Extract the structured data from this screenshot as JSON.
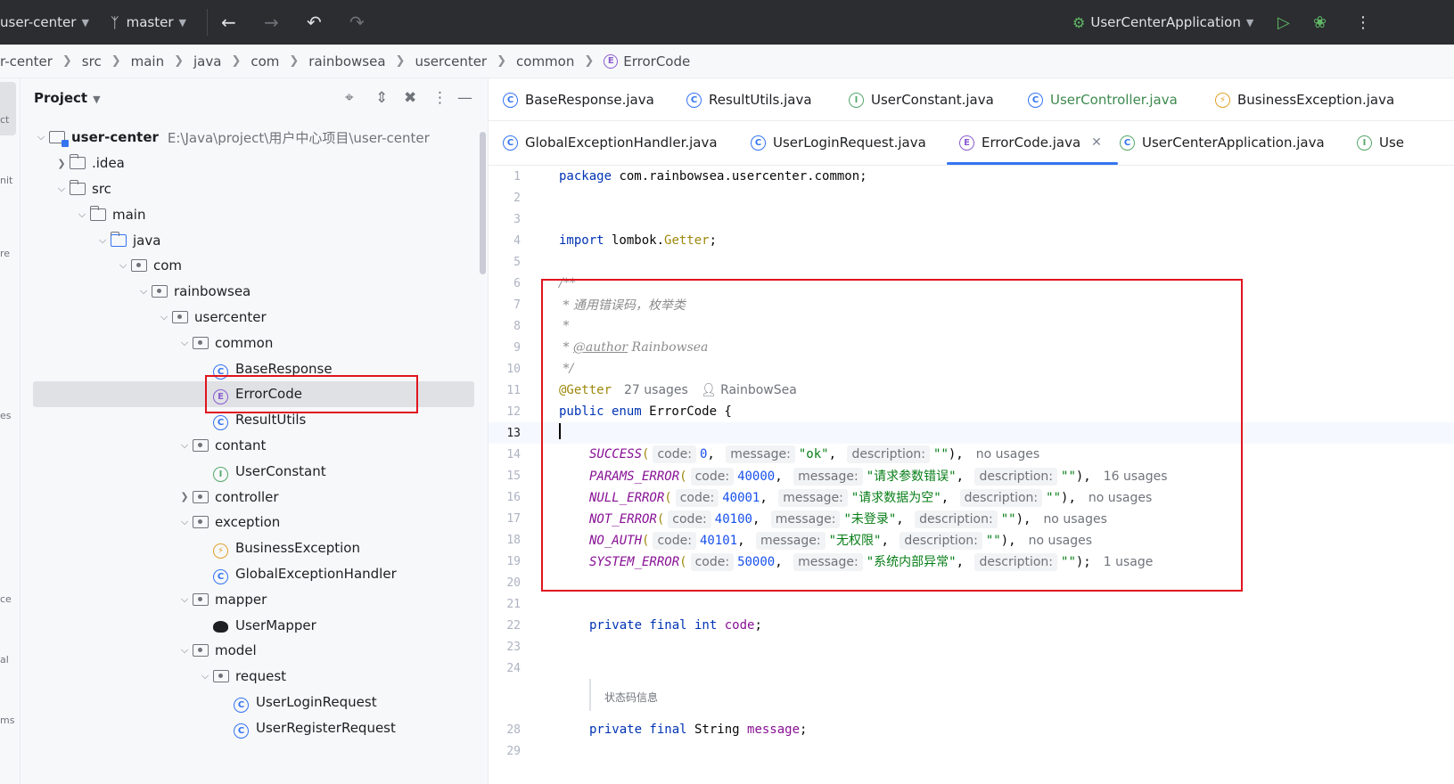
{
  "toolbar": {
    "project_name": "user-center",
    "branch": "master",
    "run_config": "UserCenterApplication"
  },
  "breadcrumb": [
    "r-center",
    "src",
    "main",
    "java",
    "com",
    "rainbowsea",
    "usercenter",
    "common",
    "ErrorCode"
  ],
  "stripe_labels": [
    "ct",
    "nit",
    "re",
    "es",
    "ce",
    "al",
    "ms"
  ],
  "project_panel": {
    "title": "Project",
    "root_name": "user-center",
    "root_path": "E:\\Java\\project\\用户中心项目\\user-center",
    "items": [
      {
        "label": ".idea"
      },
      {
        "label": "src"
      },
      {
        "label": "main"
      },
      {
        "label": "java"
      },
      {
        "label": "com"
      },
      {
        "label": "rainbowsea"
      },
      {
        "label": "usercenter"
      },
      {
        "label": "common"
      },
      {
        "label": "BaseResponse"
      },
      {
        "label": "ErrorCode"
      },
      {
        "label": "ResultUtils"
      },
      {
        "label": "contant"
      },
      {
        "label": "UserConstant"
      },
      {
        "label": "controller"
      },
      {
        "label": "exception"
      },
      {
        "label": "BusinessException"
      },
      {
        "label": "GlobalExceptionHandler"
      },
      {
        "label": "mapper"
      },
      {
        "label": "UserMapper"
      },
      {
        "label": "model"
      },
      {
        "label": "request"
      },
      {
        "label": "UserLoginRequest"
      },
      {
        "label": "UserRegisterRequest"
      }
    ]
  },
  "tabs_row1": [
    "BaseResponse.java",
    "ResultUtils.java",
    "UserConstant.java",
    "UserController.java",
    "BusinessException.java"
  ],
  "tabs_row2": [
    "GlobalExceptionHandler.java",
    "UserLoginRequest.java",
    "ErrorCode.java",
    "UserCenterApplication.java",
    "Use"
  ],
  "code": {
    "line_numbers": [
      "1",
      "2",
      "3",
      "4",
      "5",
      "6",
      "7",
      "8",
      "9",
      "10",
      "11",
      "12",
      "13",
      "14",
      "15",
      "16",
      "17",
      "18",
      "19",
      "20",
      "21",
      "22",
      "23",
      "24",
      "28",
      "29"
    ],
    "package_kw": "package",
    "package_name": " com.rainbowsea.usercenter.common;",
    "import_kw": "import",
    "import_pkg": " lombok.",
    "import_cls": "Getter",
    "import_end": ";",
    "doc_open": "/**",
    "doc_desc": " * 通用错误码，枚举类",
    "doc_star": " *",
    "doc_author_prefix": " * ",
    "doc_author_tag": "@author",
    "doc_author_name": " Rainbowsea",
    "doc_close": " */",
    "annotation": "@Getter",
    "annotation_usages": "27 usages",
    "annotation_author": "RainbowSea",
    "enum_decl_kw": "public enum",
    "enum_decl_name": " ErrorCode {",
    "hint_code": "code:",
    "hint_message": "message:",
    "hint_description": "description:",
    "enum_values": [
      {
        "name": "SUCCESS",
        "code": "0",
        "message": "\"ok\"",
        "description": "\"\"",
        "end": "),",
        "usages": "no usages"
      },
      {
        "name": "PARAMS_ERROR",
        "code": "40000",
        "message": "\"请求参数错误\"",
        "description": "\"\"",
        "end": "),",
        "usages": "16 usages"
      },
      {
        "name": "NULL_ERROR",
        "code": "40001",
        "message": "\"请求数据为空\"",
        "description": "\"\"",
        "end": "),",
        "usages": "no usages"
      },
      {
        "name": "NOT_ERROR",
        "code": "40100",
        "message": "\"未登录\"",
        "description": "\"\"",
        "end": "),",
        "usages": "no usages"
      },
      {
        "name": "NO_AUTH",
        "code": "40101",
        "message": "\"无权限\"",
        "description": "\"\"",
        "end": "),",
        "usages": "no usages"
      },
      {
        "name": "SYSTEM_ERROR",
        "code": "50000",
        "message": "\"系统内部异常\"",
        "description": "\"\"",
        "end": ");",
        "usages": "1 usage"
      }
    ],
    "field1_kw": "private final int",
    "field1_name": "code",
    "field_end": ";",
    "doc_rendered": "状态码信息",
    "field2_kw": "private final",
    "field2_type": " String ",
    "field2_name": "message"
  }
}
